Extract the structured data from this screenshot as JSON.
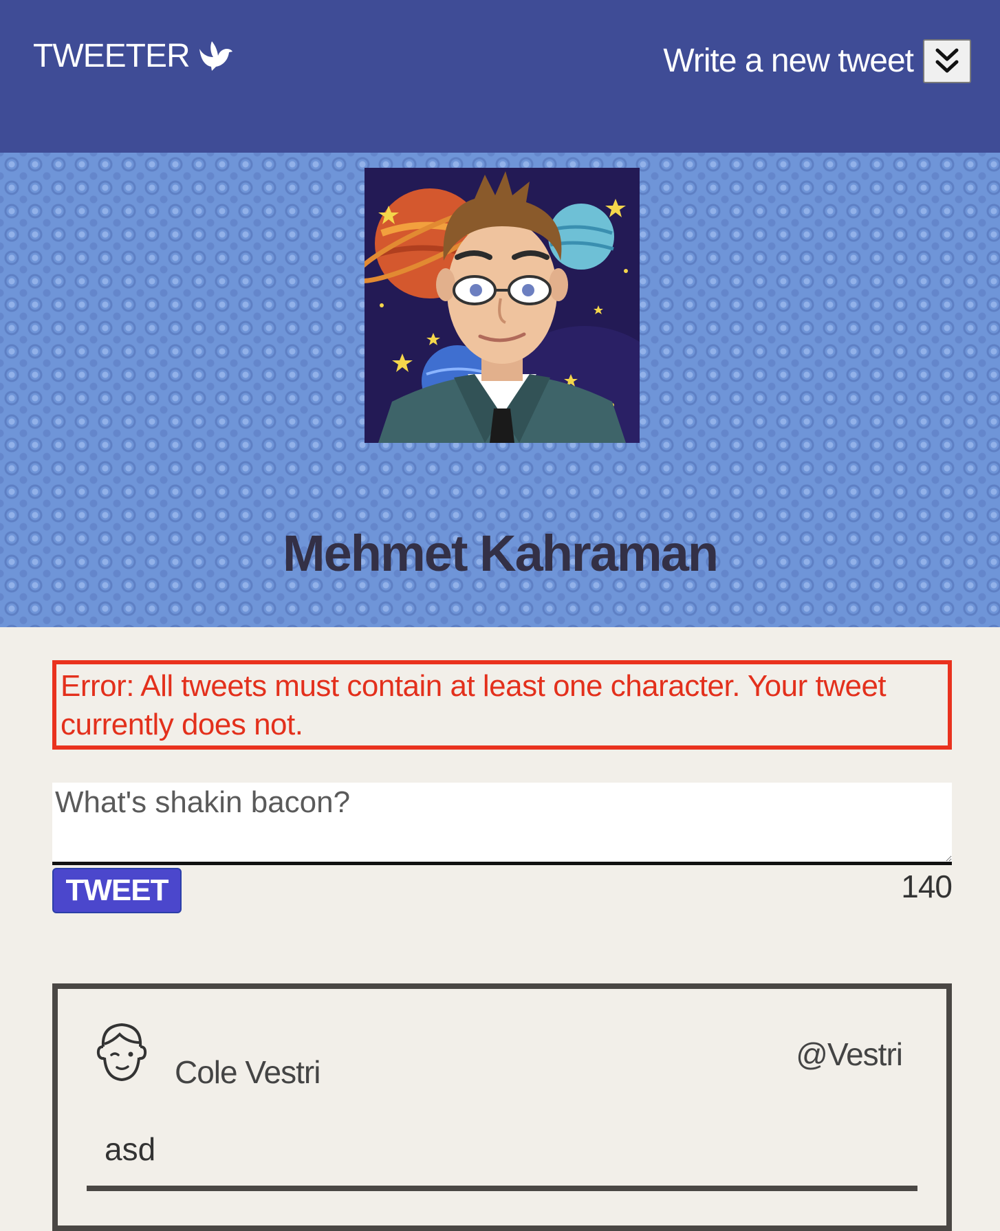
{
  "nav": {
    "brand": "TWEETER",
    "brand_icon": "dove-icon",
    "compose_label": "Write a new tweet",
    "compose_toggle_icon": "double-chevron-down-icon"
  },
  "profile": {
    "name": "Mehmet Kahraman",
    "avatar": "cartoon-avatar-space-background",
    "background_color": "#6f95d8"
  },
  "error": {
    "message": "Error: All tweets must contain at least one character. Your tweet currently does not.",
    "color": "#e3301c"
  },
  "composer": {
    "placeholder": "What's shakin bacon?",
    "value": "",
    "button_label": "TWEET",
    "button_color": "#4b47cc",
    "char_count": "140"
  },
  "tweets": [
    {
      "author_name": "Cole Vestri",
      "handle": "@Vestri",
      "text": "asd",
      "avatar_icon": "face-outline-icon"
    }
  ],
  "colors": {
    "nav_bg": "#3f4c96",
    "page_bg": "#f2efe9"
  }
}
